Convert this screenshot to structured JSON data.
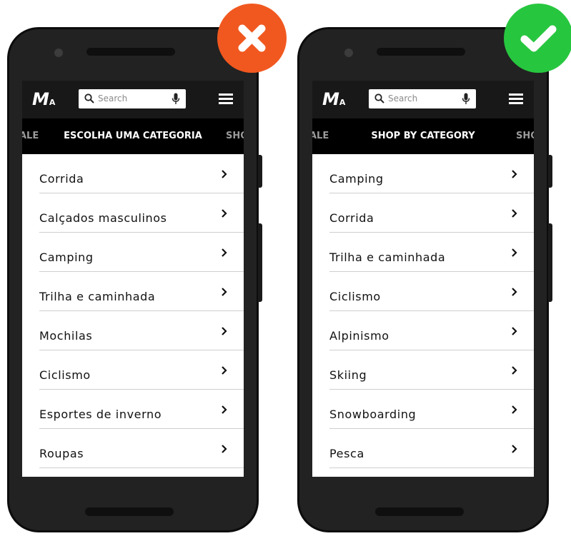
{
  "left_phone": {
    "search_placeholder": "Search",
    "category_prev": "ALE",
    "category_title": "ESCOLHA UMA CATEGORIA",
    "category_next": "SHO",
    "items": [
      {
        "label": "Corrida"
      },
      {
        "label": "Calçados masculinos"
      },
      {
        "label": "Camping"
      },
      {
        "label": "Trilha e caminhada"
      },
      {
        "label": "Mochilas"
      },
      {
        "label": "Ciclismo"
      },
      {
        "label": "Esportes de inverno"
      },
      {
        "label": "Roupas"
      }
    ]
  },
  "right_phone": {
    "search_placeholder": "Search",
    "category_prev": "ALE",
    "category_title": "SHOP BY CATEGORY",
    "category_next": "SHO",
    "items": [
      {
        "label": "Camping"
      },
      {
        "label": "Corrida"
      },
      {
        "label": "Trilha e caminhada"
      },
      {
        "label": "Ciclismo"
      },
      {
        "label": "Alpinismo"
      },
      {
        "label": "Skiing"
      },
      {
        "label": "Snowboarding"
      },
      {
        "label": "Pesca"
      }
    ]
  },
  "badges": {
    "wrong_icon": "x-mark-icon",
    "wrong_color": "#f1581f",
    "right_icon": "checkmark-icon",
    "right_color": "#27c63f"
  }
}
